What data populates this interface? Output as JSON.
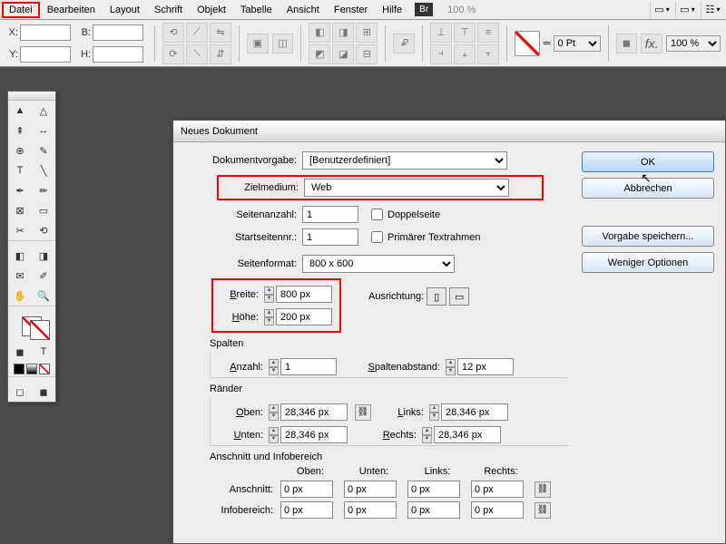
{
  "menubar": {
    "items": [
      "Datei",
      "Bearbeiten",
      "Layout",
      "Schrift",
      "Objekt",
      "Tabelle",
      "Ansicht",
      "Fenster",
      "Hilfe"
    ],
    "br": "Br",
    "zoom": "100 %"
  },
  "toolbar": {
    "labels": {
      "x": "X:",
      "y": "Y:",
      "w": "B:",
      "h": "H:"
    },
    "stroke_default": "0 Pt",
    "opacity": "100 %"
  },
  "dialog": {
    "title": "Neues Dokument",
    "labels": {
      "preset": "Dokumentvorgabe:",
      "intent": "Zielmedium:",
      "pages": "Seitenanzahl:",
      "start": "Startseitennr.:",
      "facing": "Doppelseite",
      "primary": "Primärer Textrahmen",
      "pagesize": "Seitenformat:",
      "width": "Breite:",
      "height": "Höhe:",
      "orientation": "Ausrichtung:",
      "columns_section": "Spalten",
      "col_count": "Anzahl:",
      "gutter": "Spaltenabstand:",
      "margins_section": "Ränder",
      "top": "Oben:",
      "bottom": "Unten:",
      "left": "Links:",
      "right": "Rechts:",
      "bleed_section": "Anschnitt und Infobereich",
      "bleed": "Anschnitt:",
      "slug": "Infobereich:"
    },
    "values": {
      "preset": "[Benutzerdefiniert]",
      "intent": "Web",
      "pages": "1",
      "start": "1",
      "pagesize": "800 x 600",
      "width": "800 px",
      "height": "200 px",
      "col_count": "1",
      "gutter": "12 px",
      "top": "28,346 px",
      "bottom": "28,346 px",
      "left": "28,346 px",
      "right": "28,346 px",
      "bleed_t": "0 px",
      "bleed_b": "0 px",
      "bleed_l": "0 px",
      "bleed_r": "0 px",
      "slug_t": "0 px",
      "slug_b": "0 px",
      "slug_l": "0 px",
      "slug_r": "0 px"
    },
    "buttons": {
      "ok": "OK",
      "cancel": "Abbrechen",
      "save": "Vorgabe speichern...",
      "less": "Weniger Optionen"
    }
  }
}
